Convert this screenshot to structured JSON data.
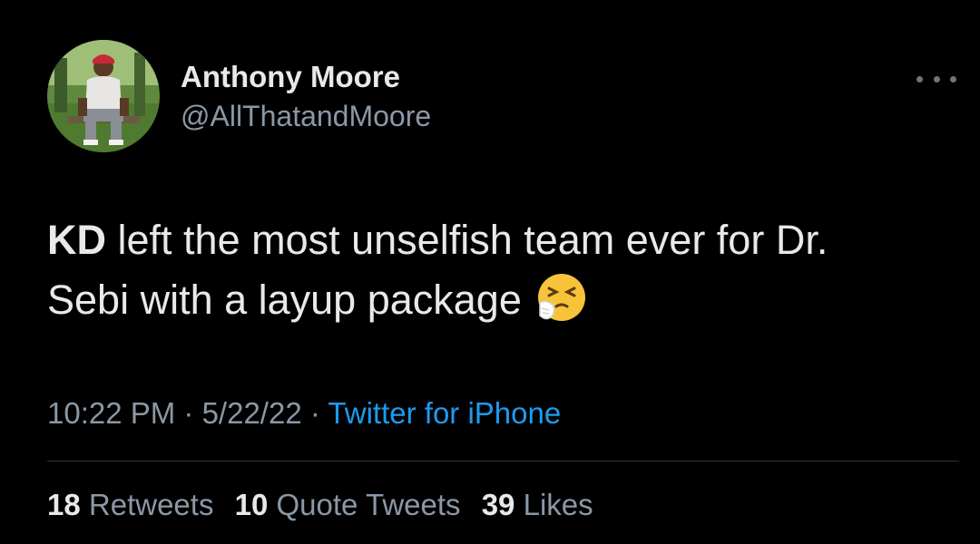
{
  "author": {
    "name": "Anthony Moore",
    "handle": "@AllThatandMoore"
  },
  "tweet": {
    "text_bold": "KD",
    "text_line1_rest": " left the most unselfish team ever for Dr.",
    "text_line2": "Sebi with a layup package",
    "emoji": "sneezing-face-icon"
  },
  "meta": {
    "time": "10:22 PM",
    "date": "5/22/22",
    "separator": " · ",
    "source": "Twitter for iPhone"
  },
  "stats": {
    "retweets_count": "18",
    "retweets_label": "Retweets",
    "quotes_count": "10",
    "quotes_label": "Quote Tweets",
    "likes_count": "39",
    "likes_label": "Likes"
  },
  "colors": {
    "background": "#000000",
    "primary_text": "#e7e9ea",
    "secondary_text": "#8b98a5",
    "link": "#1d9bf0",
    "divider": "#2f3336"
  }
}
